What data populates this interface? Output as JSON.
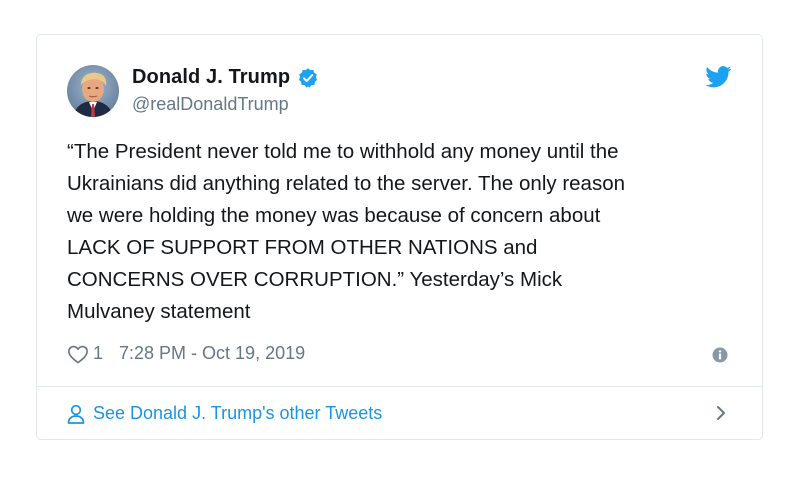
{
  "tweet": {
    "author_name": "Donald J. Trump",
    "author_handle": "@realDonaldTrump",
    "verified": true,
    "text": "“The President never told me to withhold any money until the Ukrainians did anything related to the server. The only reason we were holding the money was because of concern about LACK OF SUPPORT FROM OTHER NATIONS and CONCERNS OVER CORRUPTION.” Yesterday’s Mick Mulvaney statement",
    "text_lines": [
      "“The President never told me to withhold any money until the",
      "Ukrainians did anything related to the server. The only reason",
      "we were holding the money was because of concern about",
      "LACK OF SUPPORT FROM OTHER NATIONS and",
      "CONCERNS OVER CORRUPTION.” Yesterday’s Mick",
      "Mulvaney statement"
    ],
    "like_count": "1",
    "timestamp": "7:28 PM - Oct 19, 2019"
  },
  "footer": {
    "see_more_label": "See Donald J. Trump's other Tweets"
  },
  "icons": {
    "avatar": "avatar-photo",
    "verified": "verified-badge-icon",
    "brand": "twitter-bird-icon",
    "like": "heart-icon",
    "info": "info-icon",
    "person": "person-icon",
    "chevron": "chevron-right-icon"
  },
  "colors": {
    "text": "#14171a",
    "secondary": "#657786",
    "accent": "#1da1f2",
    "link": "#1b95e0",
    "border": "#e1e8ed"
  }
}
